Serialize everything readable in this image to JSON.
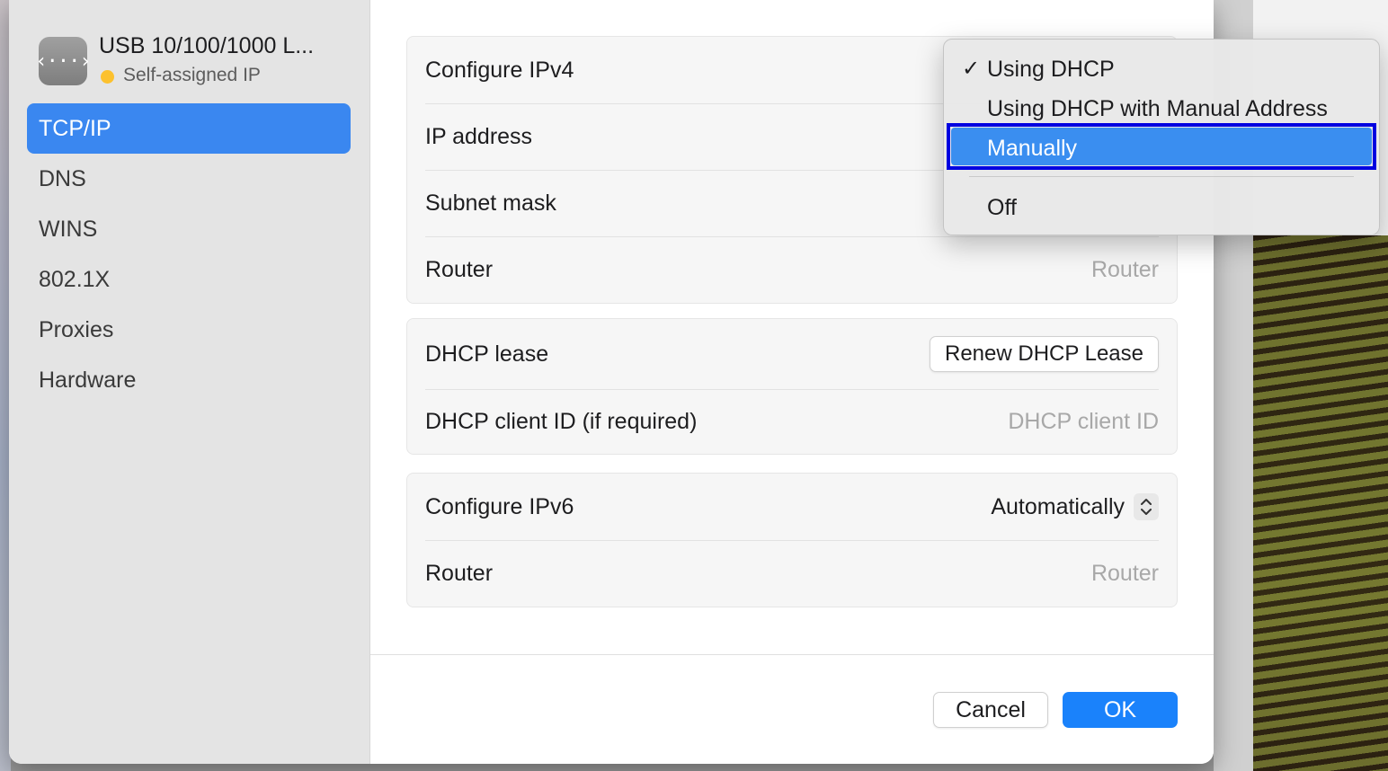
{
  "sidebar": {
    "interface_name": "USB 10/100/1000 L...",
    "icon_glyph": "‹···›",
    "status_text": "Self-assigned IP",
    "status_color": "#fcc12e",
    "items": [
      {
        "label": "TCP/IP",
        "selected": true
      },
      {
        "label": "DNS"
      },
      {
        "label": "WINS"
      },
      {
        "label": "802.1X"
      },
      {
        "label": "Proxies"
      },
      {
        "label": "Hardware"
      }
    ]
  },
  "ipv4": {
    "configure_label": "Configure IPv4",
    "ip_label": "IP address",
    "subnet_label": "Subnet mask",
    "router_label": "Router",
    "router_placeholder": "Router"
  },
  "dhcp": {
    "lease_label": "DHCP lease",
    "renew_button": "Renew DHCP Lease",
    "client_id_label": "DHCP client ID (if required)",
    "client_id_placeholder": "DHCP client ID"
  },
  "ipv6": {
    "configure_label": "Configure IPv6",
    "configure_value": "Automatically",
    "router_label": "Router",
    "router_placeholder": "Router"
  },
  "footer": {
    "cancel_label": "Cancel",
    "ok_label": "OK",
    "accent_color": "#1a82fb"
  },
  "menu": {
    "options": [
      {
        "label": "Using DHCP",
        "checked": true,
        "check_glyph": "✓"
      },
      {
        "label": "Using DHCP with Manual Address"
      },
      {
        "label": "Manually",
        "highlighted": true
      },
      {
        "label": "Off"
      }
    ]
  }
}
